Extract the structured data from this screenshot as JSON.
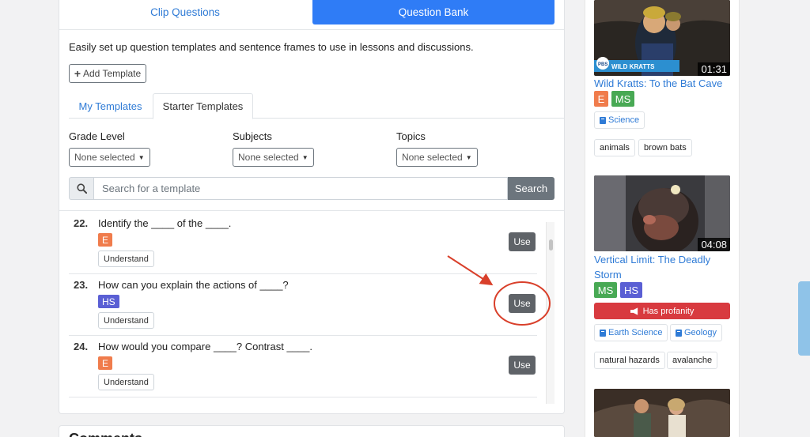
{
  "tabs": {
    "clip": "Clip Questions",
    "bank": "Question Bank"
  },
  "intro": "Easily set up question templates and sentence frames to use in lessons and discussions.",
  "add_template": "Add Template",
  "sub_tabs": {
    "my": "My Templates",
    "starter": "Starter Templates"
  },
  "filters": [
    {
      "label": "Grade Level",
      "value": "None selected"
    },
    {
      "label": "Subjects",
      "value": "None selected"
    },
    {
      "label": "Topics",
      "value": "None selected"
    }
  ],
  "search": {
    "placeholder": "Search for a template",
    "button": "Search"
  },
  "items": [
    {
      "num": "22.",
      "question": "Identify the ____ of the ____.",
      "grade": "E",
      "tag": "Understand",
      "use": "Use"
    },
    {
      "num": "23.",
      "question": "How can you explain the actions of ____?",
      "grade": "HS",
      "tag": "Understand",
      "use": "Use"
    },
    {
      "num": "24.",
      "question": "How would you compare ____? Contrast ____.",
      "grade": "E",
      "tag": "Understand",
      "use": "Use"
    }
  ],
  "comments_title": "Comments",
  "videos": [
    {
      "title": "Wild Kratts: To the Bat Cave",
      "duration": "01:31",
      "logo": "WILD KRATTS",
      "grades": [
        "E",
        "MS"
      ],
      "subjects": [
        "Science"
      ],
      "keywords": [
        "animals",
        "brown bats"
      ]
    },
    {
      "title": "Vertical Limit: The Deadly Storm",
      "duration": "04:08",
      "grades": [
        "MS",
        "HS"
      ],
      "warning": "Has profanity",
      "subjects": [
        "Earth Science",
        "Geology"
      ],
      "keywords": [
        "natural hazards",
        "avalanche"
      ]
    }
  ],
  "colors": {
    "primary": "#2f7cf6",
    "link": "#2f7bd6",
    "grade_e": "#f07c4c",
    "grade_ms": "#48a954",
    "grade_hs": "#5a5fd4",
    "danger": "#d83a3f",
    "annotation": "#d9402b"
  }
}
